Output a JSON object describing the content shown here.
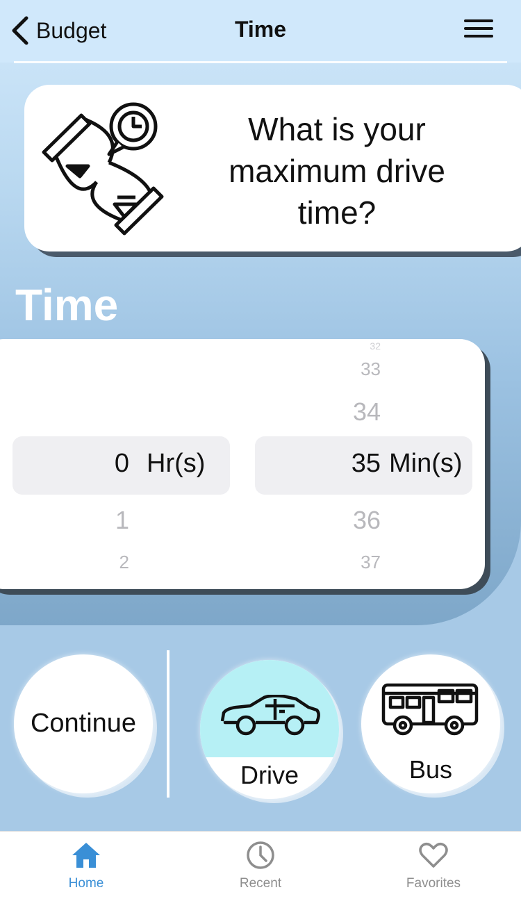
{
  "nav": {
    "back_label": "Budget",
    "title": "Time"
  },
  "question": {
    "text": "What is your maximum drive time?"
  },
  "section_title": "Time",
  "picker": {
    "hours": {
      "selected": "0",
      "below": [
        "1",
        "2"
      ],
      "unit": "Hr(s)"
    },
    "minutes": {
      "above": [
        "32",
        "33",
        "34"
      ],
      "selected": "35",
      "below": [
        "36",
        "37"
      ],
      "unit": "Min(s)"
    }
  },
  "actions": {
    "continue_label": "Continue",
    "drive_label": "Drive",
    "bus_label": "Bus",
    "drive_selected": true
  },
  "tabs": [
    {
      "label": "Home",
      "icon": "home-icon",
      "active": true
    },
    {
      "label": "Recent",
      "icon": "clock-icon",
      "active": false
    },
    {
      "label": "Favorites",
      "icon": "heart-icon",
      "active": false
    }
  ],
  "colors": {
    "accent": "#3a8fd6",
    "drive_fill": "#b6f0f5",
    "inactive_tab": "#8e8e8e"
  }
}
